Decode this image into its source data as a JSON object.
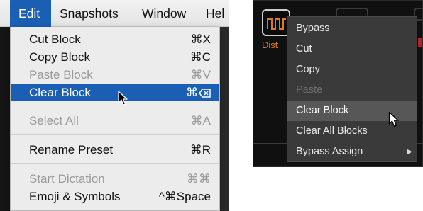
{
  "menubar": {
    "items": [
      {
        "label": "Edit"
      },
      {
        "label": "Snapshots"
      },
      {
        "label": "Window"
      },
      {
        "label": "Hel"
      }
    ]
  },
  "edit_menu": {
    "items": [
      {
        "label": "Cut Block",
        "shortcut": "⌘X",
        "enabled": true
      },
      {
        "label": "Copy Block",
        "shortcut": "⌘C",
        "enabled": true
      },
      {
        "label": "Paste Block",
        "shortcut": "⌘V",
        "enabled": false
      },
      {
        "label": "Clear Block",
        "shortcut": "⌘",
        "enabled": true,
        "highlighted": true,
        "shortcut_icon": "delete-backward-icon"
      },
      {
        "label": "Select All",
        "shortcut": "⌘A",
        "enabled": false
      },
      {
        "label": "Rename Preset",
        "shortcut": "⌘R",
        "enabled": true
      },
      {
        "label": "Start Dictation",
        "shortcut": "⌘⌘",
        "enabled": false
      },
      {
        "label": "Emoji & Symbols",
        "shortcut": "^⌘Space",
        "enabled": true
      }
    ]
  },
  "block": {
    "label": "Dist",
    "icon": "distortion-waveform-icon"
  },
  "context_menu": {
    "items": [
      {
        "label": "Bypass",
        "enabled": true
      },
      {
        "label": "Cut",
        "enabled": true
      },
      {
        "label": "Copy",
        "enabled": true
      },
      {
        "label": "Paste",
        "enabled": false
      },
      {
        "label": "Clear Block",
        "enabled": true,
        "highlighted": true
      },
      {
        "label": "Clear All Blocks",
        "enabled": true
      },
      {
        "label": "Bypass Assign",
        "enabled": true,
        "has_submenu": true
      }
    ],
    "submenu_arrow": "▶"
  },
  "colors": {
    "mac_highlight": "#1a5fb4",
    "dark_highlight": "#575757",
    "block_label": "#e07a20"
  }
}
